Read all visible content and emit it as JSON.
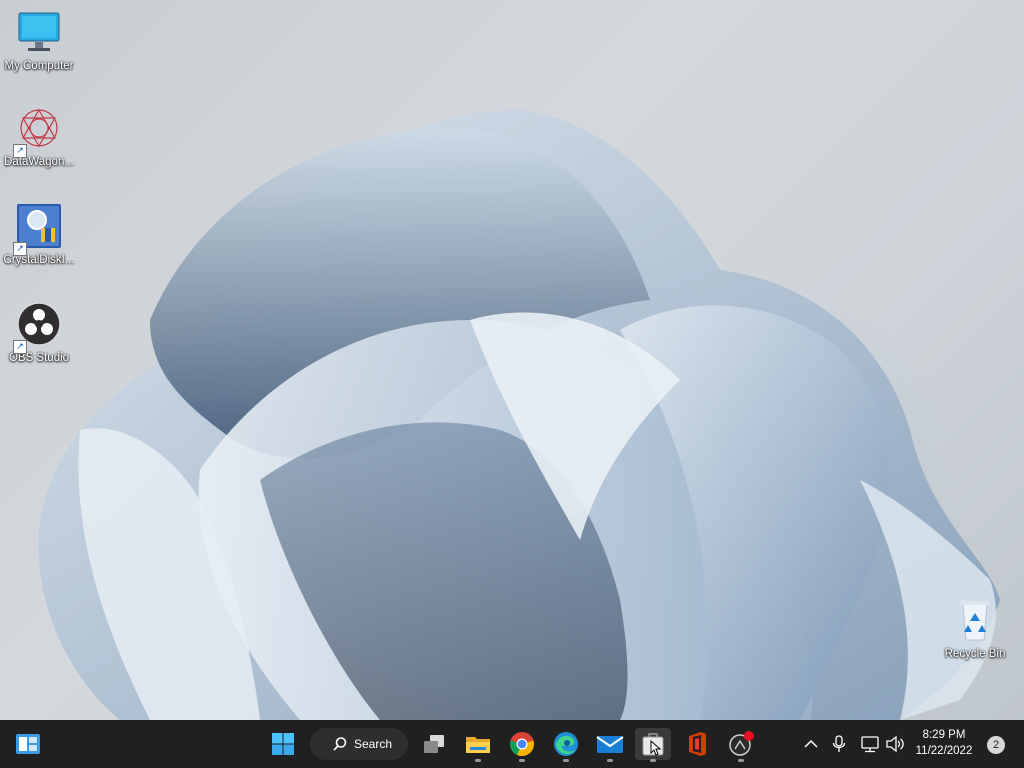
{
  "desktop": {
    "icons": [
      {
        "label": "My Computer",
        "icon": "monitor-icon"
      },
      {
        "label": "DataWagon...",
        "icon": "datawagon-icon"
      },
      {
        "label": "CrystalDiskI...",
        "icon": "crystaldisk-icon"
      },
      {
        "label": "OBS Studio",
        "icon": "obs-icon"
      }
    ],
    "recycle_bin": {
      "label": "Recycle Bin",
      "icon": "recycle-bin-icon"
    }
  },
  "taskbar": {
    "search_label": "Search",
    "apps": [
      {
        "name": "Start",
        "icon": "windows-start-icon"
      },
      {
        "name": "Task View",
        "icon": "task-view-icon"
      },
      {
        "name": "File Explorer",
        "icon": "folder-icon"
      },
      {
        "name": "Chrome",
        "icon": "chrome-icon"
      },
      {
        "name": "Edge",
        "icon": "edge-icon"
      },
      {
        "name": "Mail",
        "icon": "mail-icon"
      },
      {
        "name": "Store",
        "icon": "store-icon"
      },
      {
        "name": "Office",
        "icon": "office-icon"
      },
      {
        "name": "App",
        "icon": "app-badge-icon"
      }
    ],
    "time": "8:29 PM",
    "date": "11/22/2022",
    "notification_count": "2"
  },
  "colors": {
    "taskbar": "#202020",
    "accent": "#0078d4"
  }
}
